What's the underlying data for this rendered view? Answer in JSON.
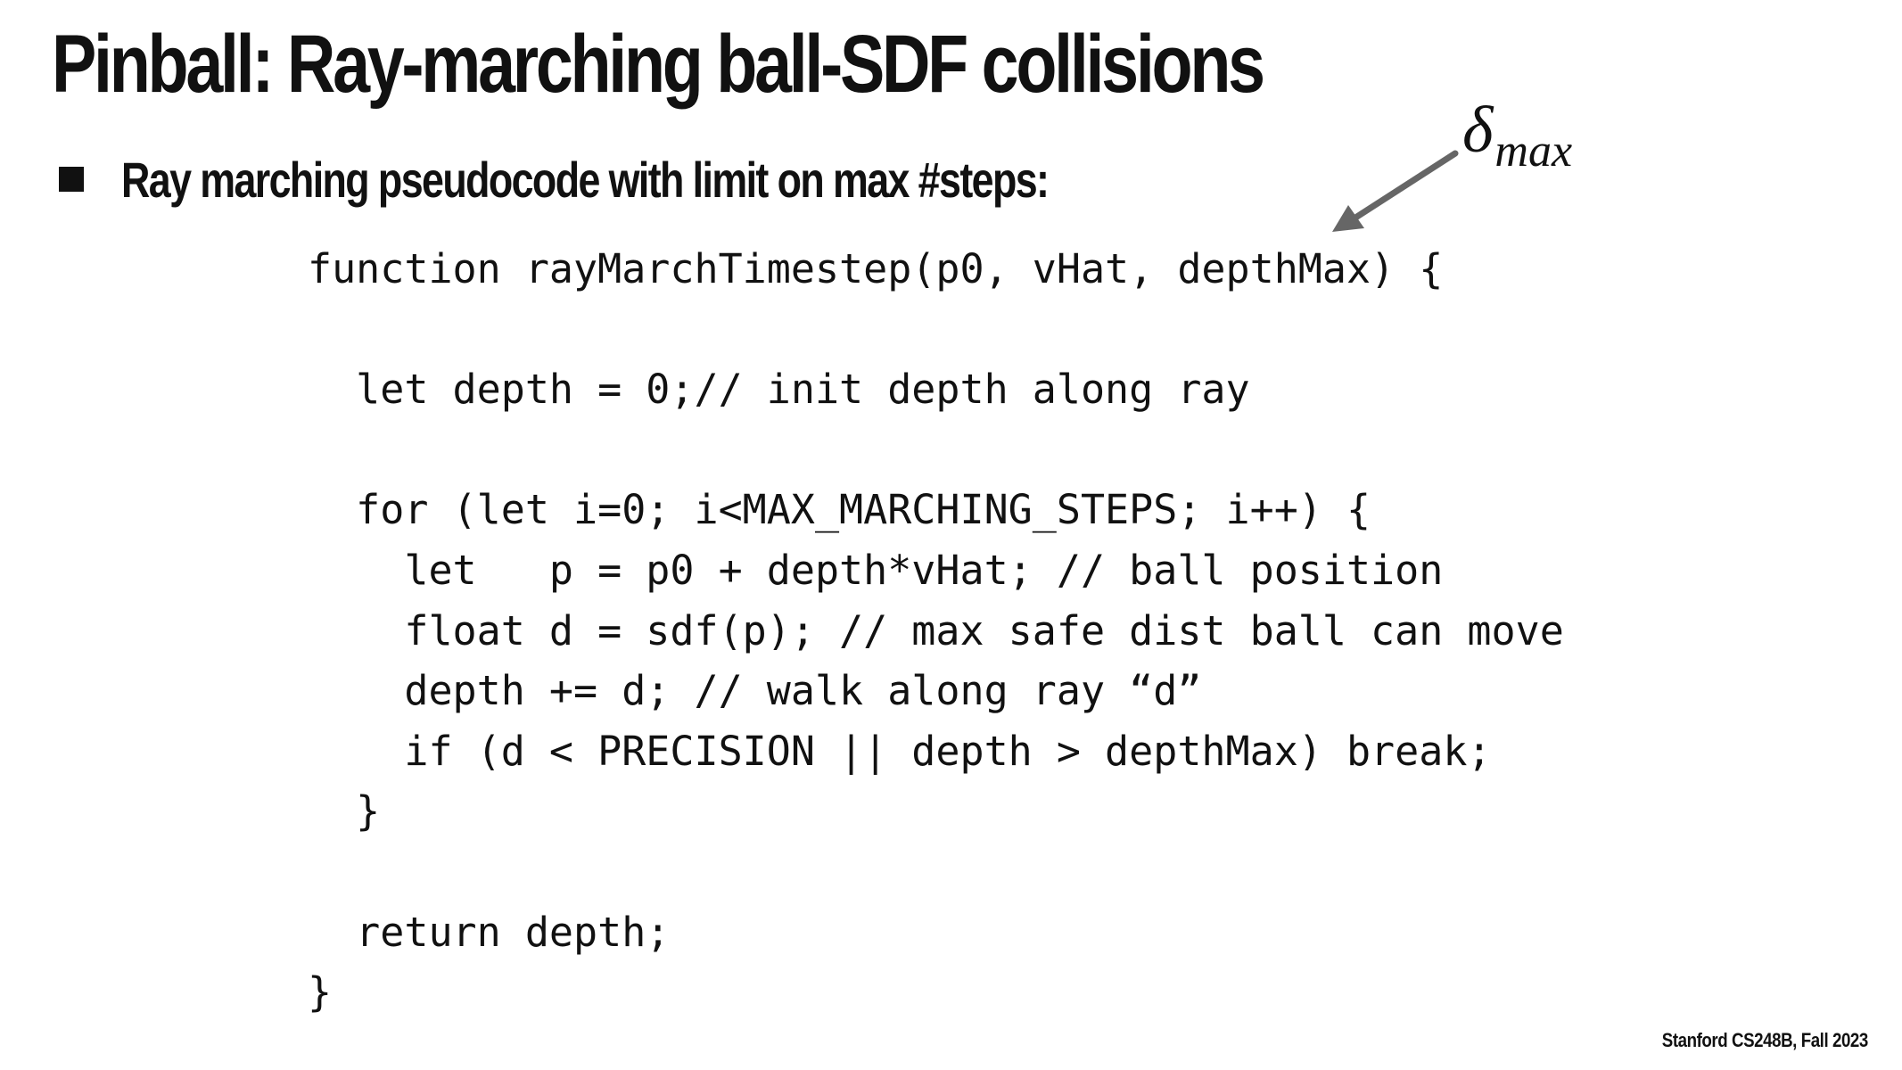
{
  "slide": {
    "title": "Pinball: Ray-marching ball-SDF collisions",
    "bullet": "Ray marching pseudocode with limit on max #steps:",
    "annotation": {
      "symbol": "δ",
      "subscript": "max"
    },
    "code_lines": [
      "function rayMarchTimestep(p0, vHat, depthMax) {",
      "",
      "  let depth = 0;// init depth along ray",
      "",
      "  for (let i=0; i<MAX_MARCHING_STEPS; i++) {",
      "    let   p = p0 + depth*vHat; // ball position",
      "    float d = sdf(p); // max safe dist ball can move",
      "    depth += d; // walk along ray “d”",
      "    if (d < PRECISION || depth > depthMax) break;",
      "  }",
      "",
      "  return depth;",
      "}"
    ],
    "footer": "Stanford CS248B, Fall 2023",
    "colors": {
      "text": "#111111",
      "arrow": "#666666",
      "background": "#ffffff"
    }
  }
}
